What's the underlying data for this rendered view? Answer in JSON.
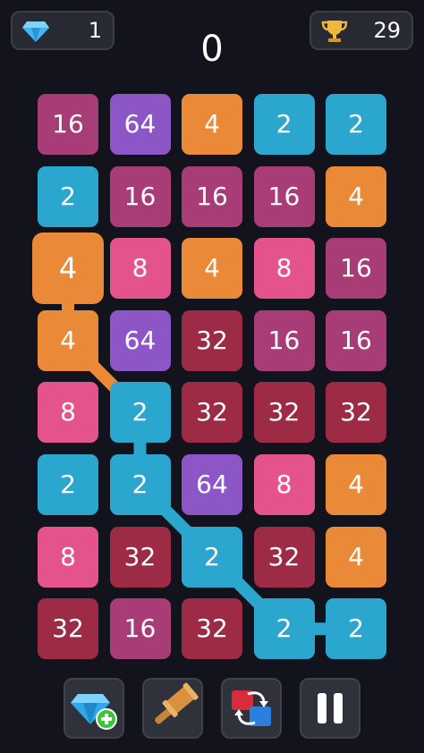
{
  "header": {
    "gems": "1",
    "best": "29",
    "score": "0"
  },
  "colors": {
    "2": "#2aa6cf",
    "4": "#ea8a38",
    "8": "#e5538d",
    "16": "#a83c76",
    "32": "#9d2b46",
    "64": "#8c56c7",
    "path": "#2aa6cf",
    "path_orange": "#ea8a38"
  },
  "board": {
    "rows": [
      [
        "16",
        "64",
        "4",
        "2",
        "2"
      ],
      [
        "2",
        "16",
        "16",
        "16",
        "4"
      ],
      [
        "4",
        "8",
        "4",
        "8",
        "16"
      ],
      [
        "4",
        "64",
        "32",
        "16",
        "16"
      ],
      [
        "8",
        "2",
        "32",
        "32",
        "32"
      ],
      [
        "2",
        "2",
        "64",
        "8",
        "4"
      ],
      [
        "8",
        "32",
        "2",
        "32",
        "4"
      ],
      [
        "32",
        "16",
        "32",
        "2",
        "2"
      ]
    ],
    "selected": [
      2,
      0
    ],
    "chain": [
      [
        2,
        0
      ],
      [
        3,
        0
      ],
      [
        4,
        1
      ],
      [
        5,
        1
      ],
      [
        6,
        2
      ],
      [
        7,
        3
      ],
      [
        7,
        4
      ]
    ]
  },
  "toolbar": [
    {
      "name": "add-gems-button",
      "icon": "gem-plus-icon"
    },
    {
      "name": "hammer-button",
      "icon": "hammer-icon"
    },
    {
      "name": "swap-button",
      "icon": "swap-icon"
    },
    {
      "name": "pause-button",
      "icon": "pause-icon"
    }
  ]
}
